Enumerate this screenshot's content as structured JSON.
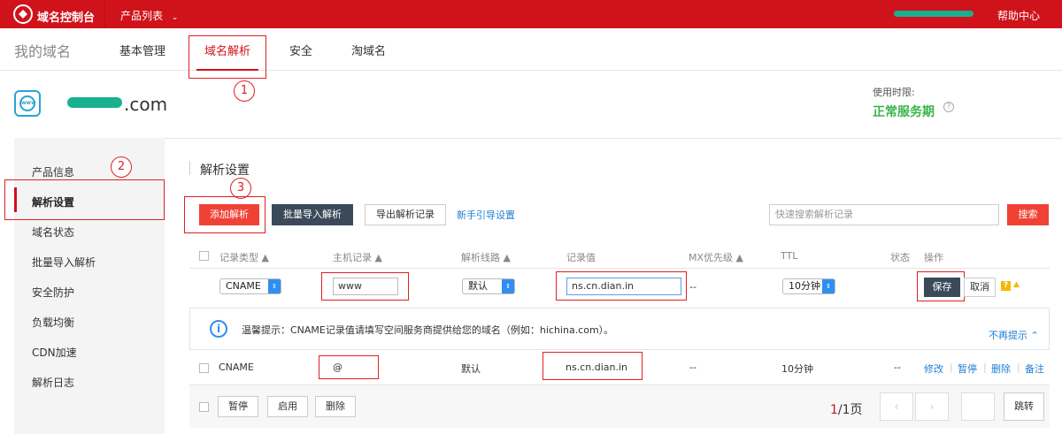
{
  "topbar": {
    "brand": "域名控制台",
    "product_list": "产品列表",
    "help": "帮助中心"
  },
  "nav": {
    "home": "我的域名",
    "items": [
      "基本管理",
      "域名解析",
      "安全",
      "淘域名"
    ]
  },
  "domain": {
    "icon_text": "www",
    "suffix": ".com",
    "usage_label": "使用时限:",
    "usage_value": "正常服务期"
  },
  "sidebar": {
    "items": [
      "产品信息",
      "解析设置",
      "域名状态",
      "批量导入解析",
      "安全防护",
      "负载均衡",
      "CDN加速",
      "解析日志"
    ]
  },
  "annotations": [
    "1",
    "2",
    "3"
  ],
  "section": {
    "title": "解析设置",
    "add_btn": "添加解析",
    "import_btn": "批量导入解析",
    "export_btn": "导出解析记录",
    "guide_link": "新手引导设置",
    "search_placeholder": "快速搜索解析记录",
    "search_btn": "搜索"
  },
  "table": {
    "headers": [
      "记录类型",
      "主机记录",
      "解析线路",
      "记录值",
      "MX优先级",
      "TTL",
      "状态",
      "操作"
    ],
    "edit_row": {
      "type": "CNAME",
      "host": "www",
      "line": "默认",
      "value": "ns.cn.dian.in",
      "mx": "--",
      "ttl": "10分钟",
      "save": "保存",
      "cancel": "取消"
    },
    "tip": {
      "text": "温馨提示：CNAME记录值请填写空间服务商提供给您的域名（例如：hichina.com）。",
      "dismiss": "不再提示"
    },
    "row": {
      "type": "CNAME",
      "host": "@",
      "line": "默认",
      "value": "ns.cn.dian.in",
      "mx": "--",
      "ttl": "10分钟",
      "status": "--",
      "ops": [
        "修改",
        "暂停",
        "删除",
        "备注"
      ]
    }
  },
  "footer": {
    "pause": "暂停",
    "enable": "启用",
    "delete": "删除",
    "page_current": "1",
    "page_total": "/1页",
    "jump": "跳转"
  }
}
